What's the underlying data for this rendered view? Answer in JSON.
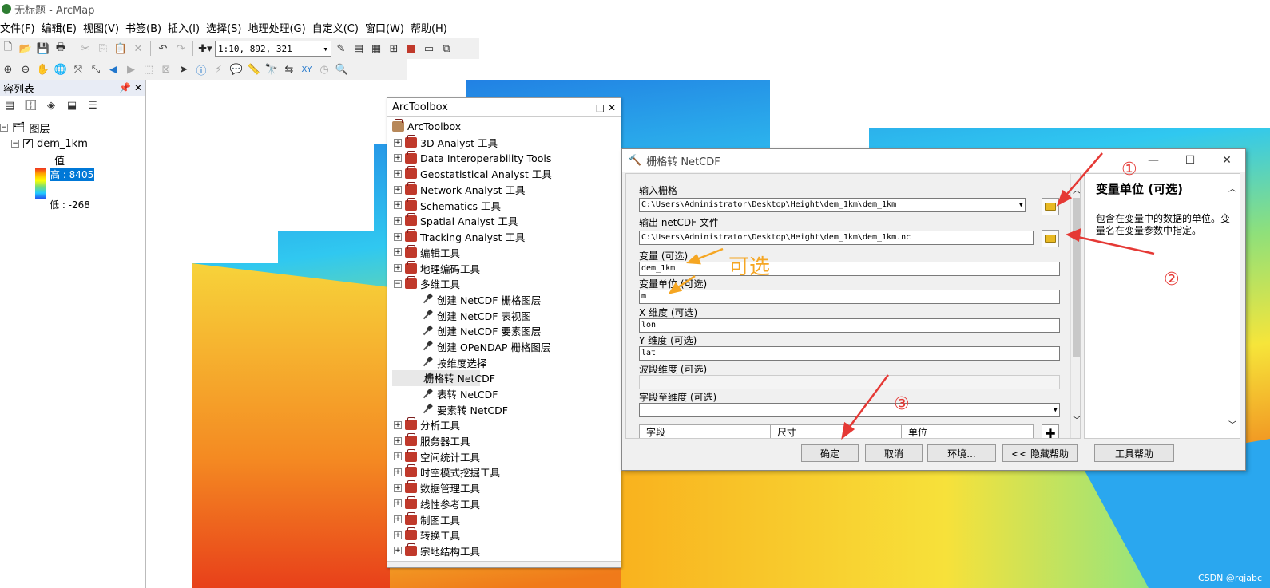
{
  "window": {
    "title": "无标题 - ArcMap"
  },
  "menu": [
    "文件(F)",
    "编辑(E)",
    "视图(V)",
    "书签(B)",
    "插入(I)",
    "选择(S)",
    "地理处理(G)",
    "自定义(C)",
    "窗口(W)",
    "帮助(H)"
  ],
  "toolbar": {
    "scale": "1:10, 892, 321"
  },
  "toc": {
    "title": "容列表",
    "layers_label": "图层",
    "layer_name": "dem_1km",
    "value_label": "值",
    "high_label": "高 : 8405",
    "low_label": "低 : -268"
  },
  "toolbox": {
    "title": "ArcToolbox",
    "root": "ArcToolbox",
    "items": [
      "3D Analyst 工具",
      "Data Interoperability Tools",
      "Geostatistical Analyst 工具",
      "Network Analyst 工具",
      "Schematics 工具",
      "Spatial Analyst 工具",
      "Tracking Analyst 工具",
      "编辑工具",
      "地理编码工具",
      "多维工具"
    ],
    "sub_items": [
      "创建 NetCDF 栅格图层",
      "创建 NetCDF 表视图",
      "创建 NetCDF 要素图层",
      "创建 OPeNDAP 栅格图层",
      "按维度选择",
      "栅格转 NetCDF",
      "表转 NetCDF",
      "要素转 NetCDF"
    ],
    "items_after": [
      "分析工具",
      "服务器工具",
      "空间统计工具",
      "时空模式挖掘工具",
      "数据管理工具",
      "线性参考工具",
      "制图工具",
      "转换工具",
      "宗地结构工具"
    ]
  },
  "dialog": {
    "title": "栅格转 NetCDF",
    "input_raster_label": "输入栅格",
    "input_raster_value": "C:\\Users\\Administrator\\Desktop\\Height\\dem_1km\\dem_1km",
    "output_label": "输出 netCDF 文件",
    "output_value": "C:\\Users\\Administrator\\Desktop\\Height\\dem_1km\\dem_1km.nc",
    "variable_label": "变量 (可选)",
    "variable_value": "dem_1km",
    "unit_label": "变量单位 (可选)",
    "unit_value": "m",
    "x_label": "X 维度 (可选)",
    "x_value": "lon",
    "y_label": "Y 维度 (可选)",
    "y_value": "lat",
    "band_label": "波段维度 (可选)",
    "field_label": "字段至维度 (可选)",
    "table_headers": [
      "字段",
      "尺寸",
      "单位"
    ],
    "buttons": {
      "ok": "确定",
      "cancel": "取消",
      "env": "环境...",
      "hide_help": "<< 隐藏帮助",
      "tool_help": "工具帮助"
    },
    "help_title": "变量单位 (可选)",
    "help_text": "包含在变量中的数据的单位。变量名在变量参数中指定。"
  },
  "annotations": {
    "optional": "可选",
    "c1": "①",
    "c2": "②",
    "c3": "③"
  },
  "watermark": "CSDN @rqjabc",
  "colors": {
    "annotation_red": "#e53935",
    "annotation_yellow": "#f5a623"
  }
}
